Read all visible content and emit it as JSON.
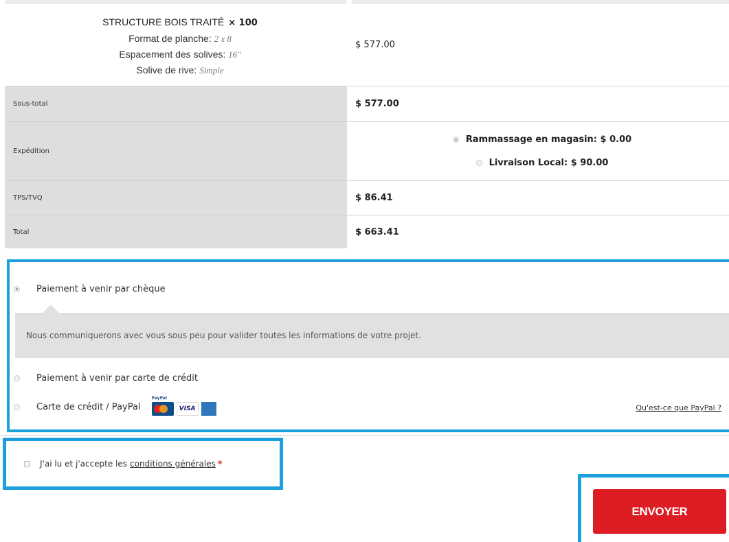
{
  "product": {
    "name": "STRUCTURE BOIS TRAITÉ",
    "quantity": "× 100",
    "attributes": [
      {
        "label": "Format de planche:",
        "value": "2 x 8"
      },
      {
        "label": "Espacement des solives:",
        "value": "16\""
      },
      {
        "label": "Solive de rive:",
        "value": "Simple"
      }
    ],
    "price": "$ 577.00"
  },
  "totals": {
    "subtotal_label": "Sous-total",
    "subtotal_value": "$ 577.00",
    "shipping_label": "Expédition",
    "shipping_options": [
      {
        "label": "Rammassage en magasin: $ 0.00",
        "selected": true
      },
      {
        "label": "Livraison Local: $ 90.00",
        "selected": false
      }
    ],
    "tax_label": "TPS/TVQ",
    "tax_value": "$ 86.41",
    "total_label": "Total",
    "total_value": "$ 663.41"
  },
  "payment": {
    "methods": [
      {
        "label": "Paiement à venir par chèque",
        "selected": true
      },
      {
        "label": "Paiement à venir par carte de crédit",
        "selected": false
      },
      {
        "label": "Carte de crédit / PayPal",
        "selected": false
      }
    ],
    "cheque_description": "Nous communiquerons avec vous sous peu pour valider toutes les informations de votre projet.",
    "paypal_link": "Qu'est-ce que PayPal ?",
    "card_logos": [
      "paypal-mastercard-icon",
      "visa-icon",
      "amex-icon"
    ],
    "paypal_tag": "PayPal",
    "visa_text": "VISA"
  },
  "terms": {
    "text": "J'ai lu et j'accepte les",
    "link": "conditions générales",
    "required_mark": "*"
  },
  "submit": {
    "label": "ENVOYER"
  },
  "colors": {
    "accent_border": "#1ba0dd",
    "submit_bg": "#dd1d23",
    "label_cell_bg": "#dedede"
  }
}
